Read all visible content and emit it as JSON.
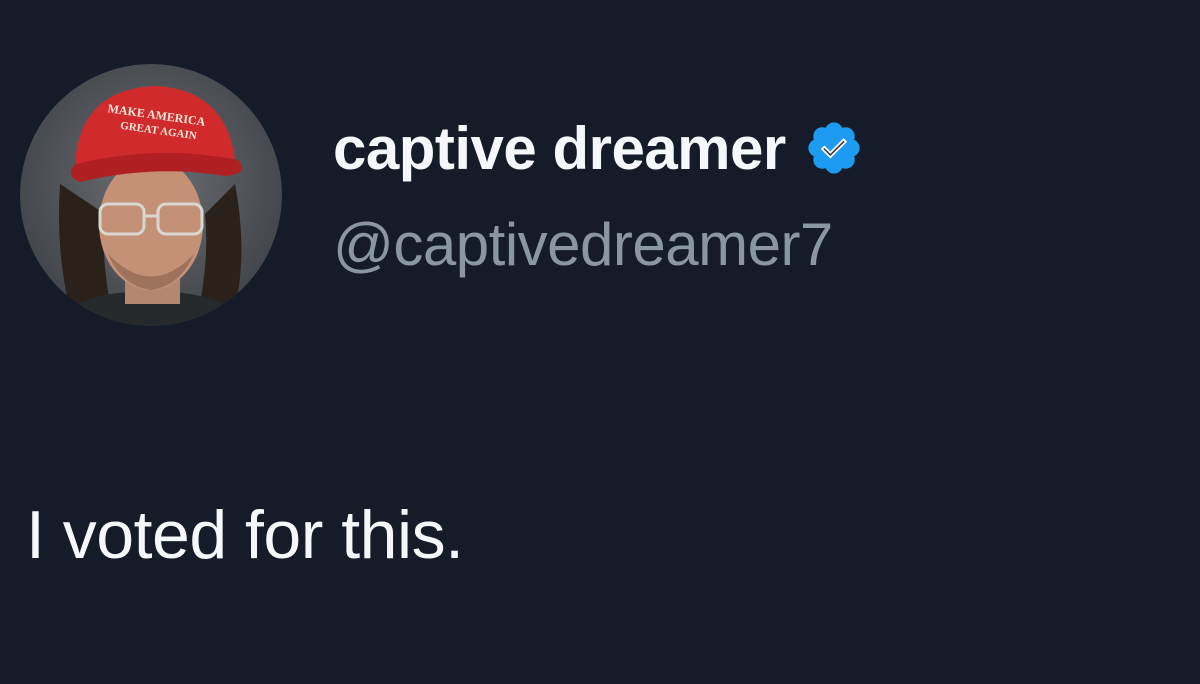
{
  "author": {
    "display_name": "captive dreamer",
    "handle": "@captivedreamer7",
    "verified": true,
    "avatar_icon": "profile-photo-man-red-cap",
    "avatar_cap_text": "MAKE AMERICA GREAT AGAIN"
  },
  "tweet": {
    "text": "I voted for this."
  },
  "colors": {
    "background": "#151b28",
    "display_name": "#f5f7fa",
    "handle": "#8b96a3",
    "verified_badge": "#1d9bf0",
    "cap_red": "#d12a2c"
  }
}
